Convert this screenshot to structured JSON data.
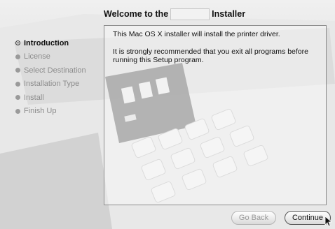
{
  "window": {
    "title_prefix": "Welcome to the",
    "title_suffix": "Installer"
  },
  "steps": [
    {
      "label": "Introduction",
      "active": true
    },
    {
      "label": "License",
      "active": false
    },
    {
      "label": "Select Destination",
      "active": false
    },
    {
      "label": "Installation Type",
      "active": false
    },
    {
      "label": "Install",
      "active": false
    },
    {
      "label": "Finish Up",
      "active": false
    }
  ],
  "content": {
    "paragraph1": "This Mac OS X installer will install the printer driver.",
    "paragraph2": "It is strongly recommended that you exit all programs before running this Setup program."
  },
  "buttons": {
    "back_label": "Go Back",
    "continue_label": "Continue"
  }
}
